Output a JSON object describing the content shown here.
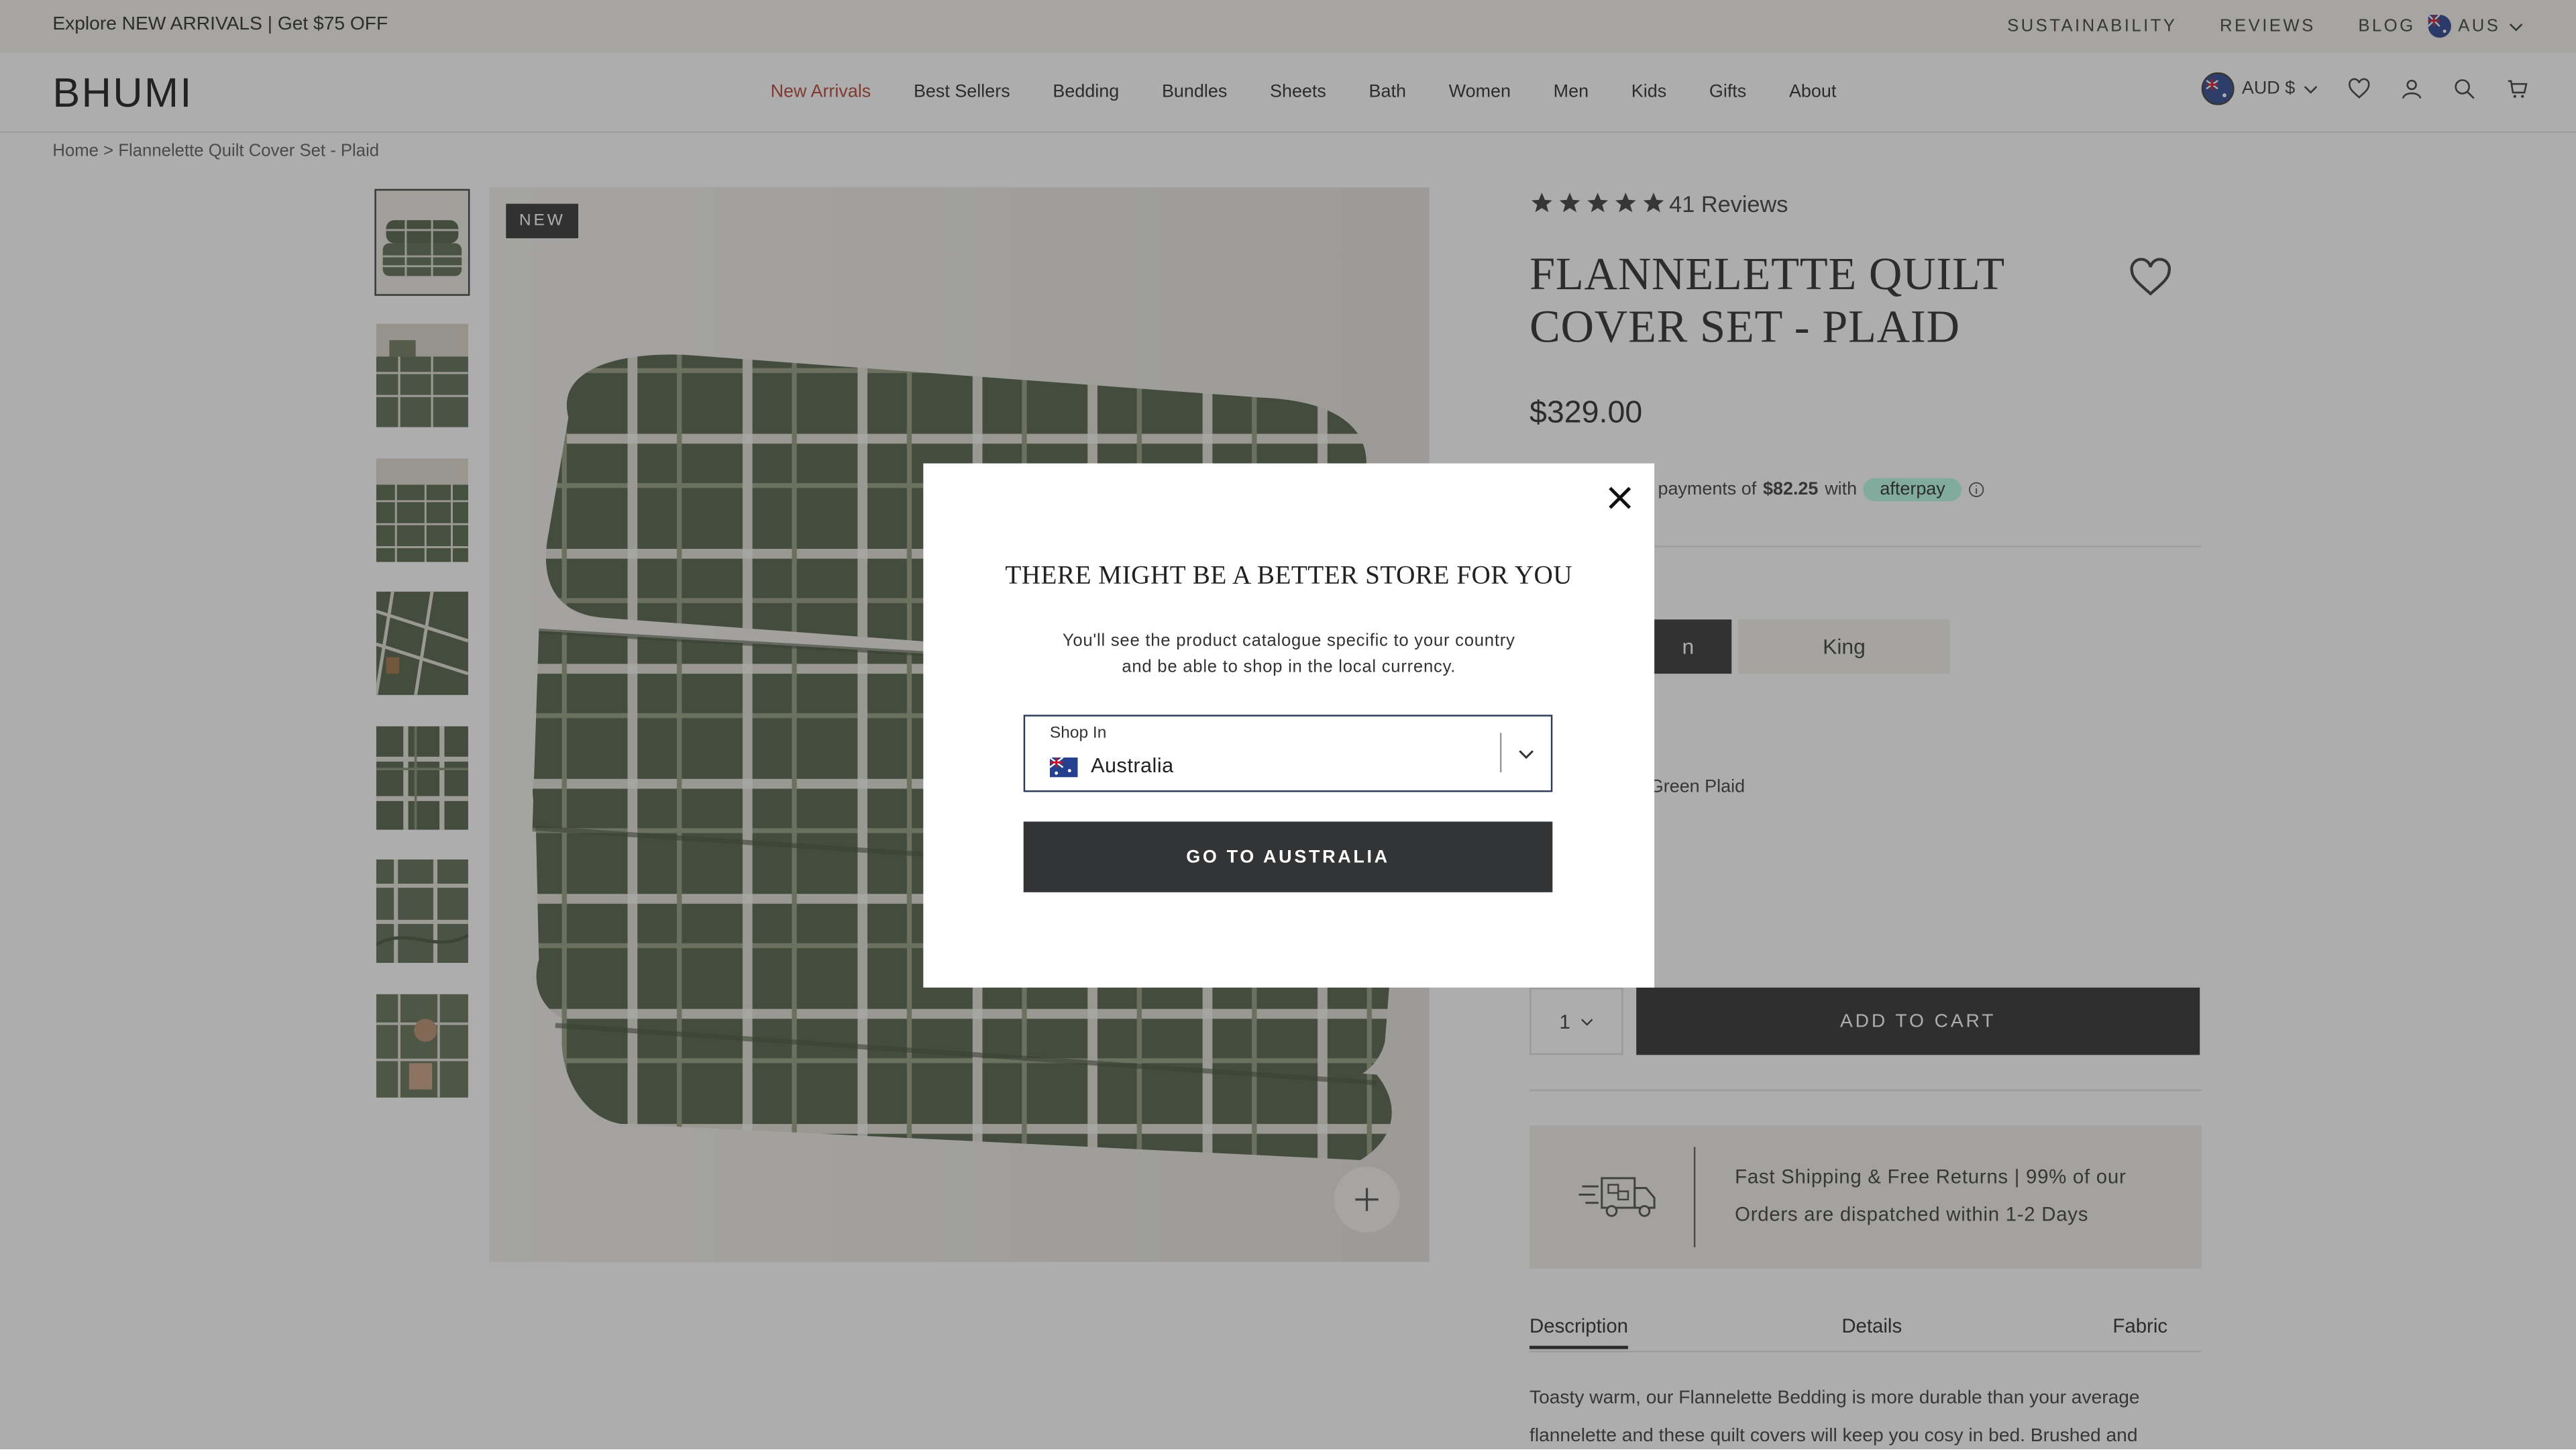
{
  "announcement": {
    "promo": "Explore NEW ARRIVALS | Get $75 OFF",
    "links": [
      "SUSTAINABILITY",
      "REVIEWS",
      "BLOG"
    ],
    "region": "AUS"
  },
  "header": {
    "logo": "BHUMI",
    "nav": [
      "New Arrivals",
      "Best Sellers",
      "Bedding",
      "Bundles",
      "Sheets",
      "Bath",
      "Women",
      "Men",
      "Kids",
      "Gifts",
      "About"
    ],
    "currency": "AUD $"
  },
  "breadcrumb": {
    "home": "Home",
    "separator": ">",
    "current": "Flannelette Quilt Cover Set - Plaid"
  },
  "gallery": {
    "badge": "NEW",
    "thumb_count": 7
  },
  "product": {
    "rating_stars": 5,
    "reviews": "41 Reviews",
    "title": "FLANNELETTE QUILT COVER SET - PLAID",
    "price": "$329.00",
    "afterpay_text_pre": "e payments of",
    "afterpay_amount": "$82.25",
    "afterpay_text_with": "with",
    "afterpay_brand": "afterpay",
    "size_selected_partial": "n",
    "size_option": "King",
    "colour": "Green Plaid",
    "quantity": "1",
    "add_to_cart": "ADD TO CART",
    "shipping": "Fast Shipping & Free Returns | 99% of our Orders are dispatched within 1-2 Days",
    "tabs": [
      "Description",
      "Details",
      "Fabric"
    ],
    "description": "Toasty warm, our Flannelette Bedding is more durable than your average flannelette and these quilt covers will keep you cosy in bed. Brushed and"
  },
  "modal": {
    "title": "THERE MIGHT BE A BETTER STORE FOR YOU",
    "body": "You'll see the product catalogue specific to your country and be able to shop in the local currency.",
    "select_label": "Shop In",
    "select_value": "Australia",
    "button": "GO TO AUSTRALIA"
  },
  "colors": {
    "accent_red": "#b23a2a",
    "dark_button": "#333436",
    "afterpay_mint": "#b2fce4",
    "plaid_green": "#4b5a3e"
  }
}
